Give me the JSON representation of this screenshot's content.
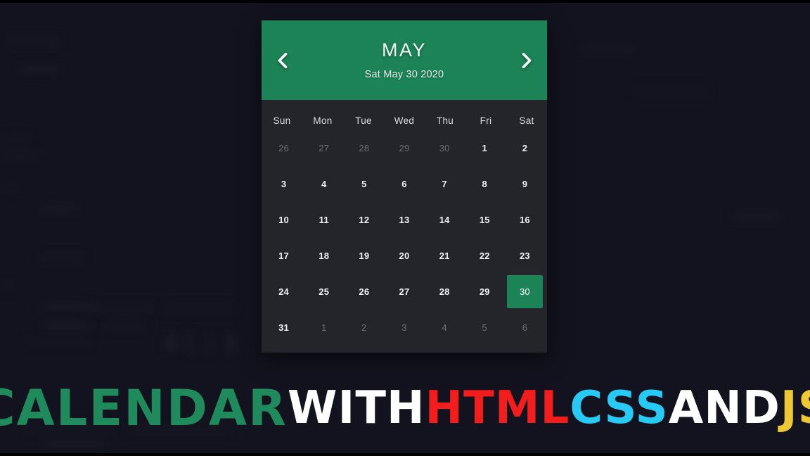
{
  "theme": {
    "page_background": "#13131f",
    "card_background": "#24242b",
    "accent_green": "#1b8356",
    "muted_text": "#6d6d78",
    "primary_text": "#f0f0f4"
  },
  "calendar": {
    "header": {
      "month": "MAY",
      "date_string": "Sat May 30 2020",
      "prev_icon": "chevron-left-icon",
      "next_icon": "chevron-right-icon"
    },
    "weekdays": [
      "Sun",
      "Mon",
      "Tue",
      "Wed",
      "Thu",
      "Fri",
      "Sat"
    ],
    "days": [
      {
        "label": "26",
        "state": "muted"
      },
      {
        "label": "27",
        "state": "muted"
      },
      {
        "label": "28",
        "state": "muted"
      },
      {
        "label": "29",
        "state": "muted"
      },
      {
        "label": "30",
        "state": "muted"
      },
      {
        "label": "1",
        "state": "current"
      },
      {
        "label": "2",
        "state": "current"
      },
      {
        "label": "3",
        "state": "current"
      },
      {
        "label": "4",
        "state": "current"
      },
      {
        "label": "5",
        "state": "current"
      },
      {
        "label": "6",
        "state": "current"
      },
      {
        "label": "7",
        "state": "current"
      },
      {
        "label": "8",
        "state": "current"
      },
      {
        "label": "9",
        "state": "current"
      },
      {
        "label": "10",
        "state": "current"
      },
      {
        "label": "11",
        "state": "current"
      },
      {
        "label": "12",
        "state": "current"
      },
      {
        "label": "13",
        "state": "current"
      },
      {
        "label": "14",
        "state": "current"
      },
      {
        "label": "15",
        "state": "current"
      },
      {
        "label": "16",
        "state": "current"
      },
      {
        "label": "17",
        "state": "current"
      },
      {
        "label": "18",
        "state": "current"
      },
      {
        "label": "19",
        "state": "current"
      },
      {
        "label": "20",
        "state": "current"
      },
      {
        "label": "21",
        "state": "current"
      },
      {
        "label": "22",
        "state": "current"
      },
      {
        "label": "23",
        "state": "current"
      },
      {
        "label": "24",
        "state": "current"
      },
      {
        "label": "25",
        "state": "current"
      },
      {
        "label": "26",
        "state": "current"
      },
      {
        "label": "27",
        "state": "current"
      },
      {
        "label": "28",
        "state": "current"
      },
      {
        "label": "29",
        "state": "current"
      },
      {
        "label": "30",
        "state": "today"
      },
      {
        "label": "31",
        "state": "current"
      },
      {
        "label": "1",
        "state": "muted"
      },
      {
        "label": "2",
        "state": "muted"
      },
      {
        "label": "3",
        "state": "muted"
      },
      {
        "label": "4",
        "state": "muted"
      },
      {
        "label": "5",
        "state": "muted"
      },
      {
        "label": "6",
        "state": "muted"
      }
    ]
  },
  "banner": {
    "words": [
      {
        "text": "CALENDAR",
        "color": "#1f8a5c",
        "size": "big"
      },
      {
        "text": "WITH",
        "color": "#ffffff",
        "size": "normal"
      },
      {
        "text": "HTML",
        "color": "#f31d1d",
        "size": "normal"
      },
      {
        "text": "CSS",
        "color": "#27c9f5",
        "size": "normal"
      },
      {
        "text": "AND",
        "color": "#ffffff",
        "size": "normal"
      },
      {
        "text": "JS",
        "color": "#edc832",
        "size": "normal"
      }
    ]
  }
}
